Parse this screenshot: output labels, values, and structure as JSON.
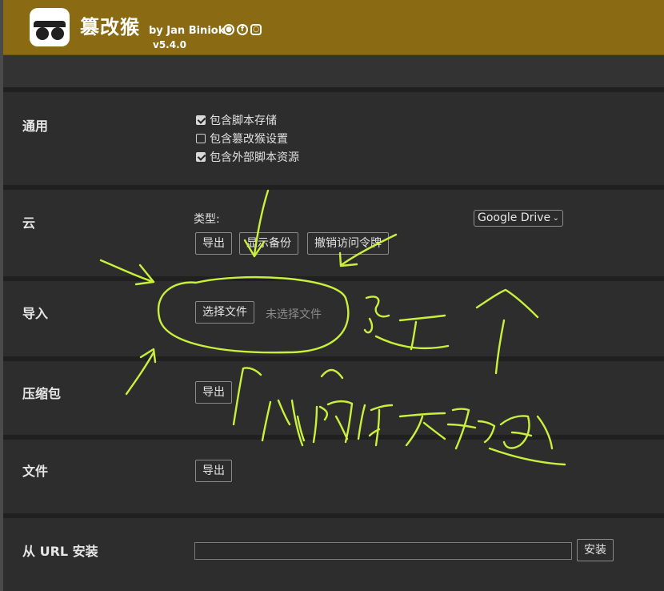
{
  "header": {
    "title": "篡改猴",
    "byline": "by Jan Biniok",
    "version": "v5.4.0",
    "social_icons": [
      "github-icon",
      "facebook-icon",
      "instagram-icon"
    ]
  },
  "sections": {
    "general": {
      "label": "通用",
      "options": [
        {
          "label": "包含脚本存储",
          "checked": true
        },
        {
          "label": "包含篡改猴设置",
          "checked": false
        },
        {
          "label": "包含外部脚本资源",
          "checked": true
        }
      ]
    },
    "cloud": {
      "label": "云",
      "type_label": "类型:",
      "type_value": "Google Drive",
      "buttons": [
        "导出",
        "显示备份",
        "撤销访问令牌"
      ]
    },
    "import": {
      "label": "导入",
      "choose_file": "选择文件",
      "no_file": "未选择文件"
    },
    "zip": {
      "label": "压缩包",
      "export": "导出"
    },
    "file": {
      "label": "文件",
      "export": "导出"
    },
    "url_install": {
      "label": "从 URL 安装",
      "install": "安装",
      "value": ""
    }
  },
  "colors": {
    "header": "#8a6b13",
    "background": "#2d2d2d",
    "annotation": "#c8f03c"
  }
}
